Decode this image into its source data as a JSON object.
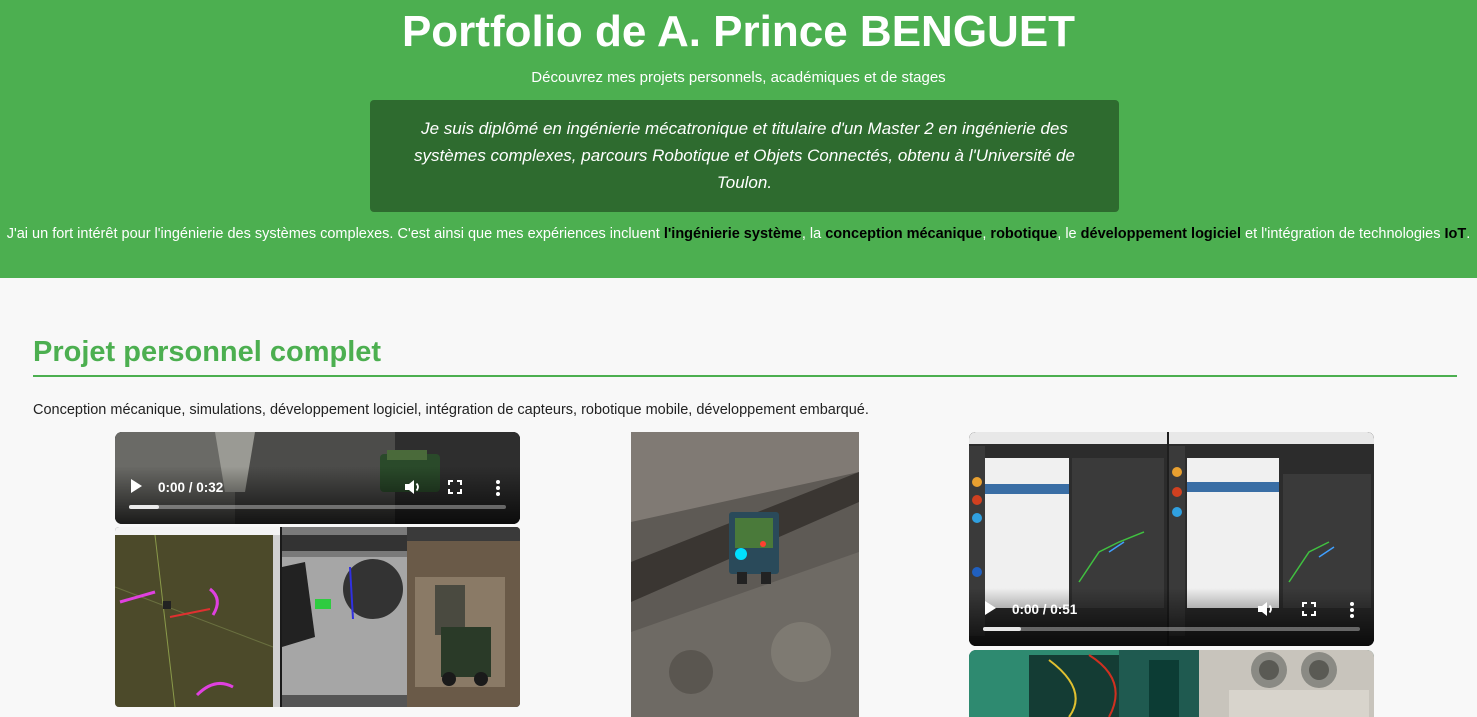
{
  "header": {
    "title": "Portfolio de A. Prince BENGUET",
    "subtitle": "Découvrez mes projets personnels, académiques et de stages",
    "bio": "Je suis diplômé en ingénierie mécatronique et titulaire d'un Master 2 en ingénierie des systèmes complexes, parcours Robotique et Objets Connectés, obtenu à l'Université de Toulon.",
    "interests": {
      "part1": "J'ai un fort intérêt pour l'ingénierie des systèmes complexes. C'est ainsi que mes expériences incluent ",
      "k1": "l'ingénierie système",
      "sep1": ", la ",
      "k2": "conception mécanique",
      "sep2": ", ",
      "k3": "robotique",
      "sep3": ", le ",
      "k4": "développement logiciel",
      "sep4": " et l'intégration de technologies ",
      "k5": "IoT",
      "end": "."
    }
  },
  "section": {
    "title": "Projet personnel complet",
    "description": "Conception mécanique, simulations, développement logiciel, intégration de capteurs, robotique mobile, développement embarqué."
  },
  "videos": [
    {
      "time": "0:00 / 0:32",
      "progress": 0.08
    },
    {
      "time": "0:00 / 0:51",
      "progress": 0.1
    }
  ],
  "icons": {
    "play": "play-icon",
    "volume": "volume-icon",
    "fullscreen": "fullscreen-icon",
    "more": "more-options-icon"
  },
  "colors": {
    "header_bg": "#4caf50",
    "bio_bg": "#2e6b2f",
    "accent": "#4caf50",
    "page_bg": "#f8f8f8"
  }
}
